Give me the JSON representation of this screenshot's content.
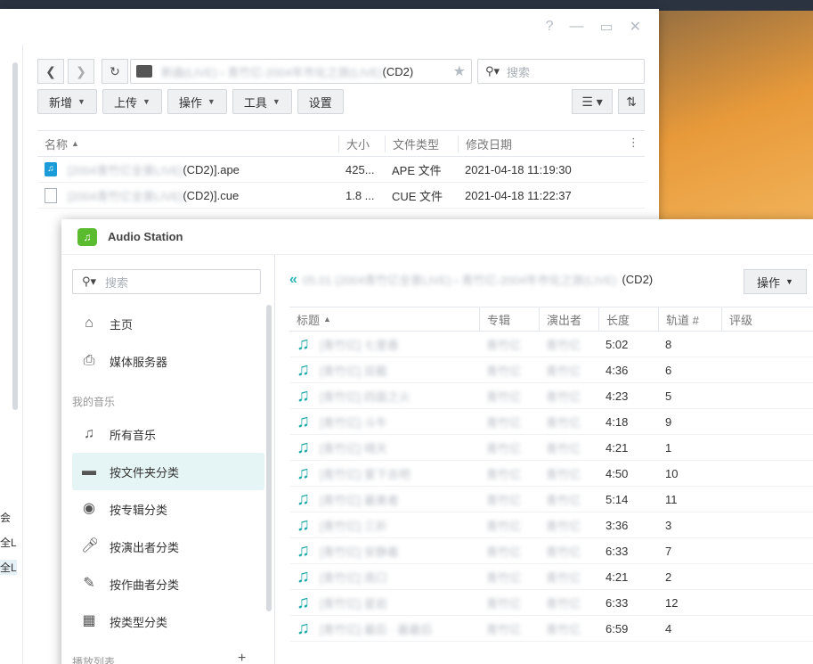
{
  "file_station": {
    "window_controls": [
      "?",
      "—",
      "▭",
      "✕"
    ],
    "path": {
      "blurred_prefix": "新曲(LIVE)  ›  青竹亿-2004年市化之旅(LIVE)",
      "visible_suffix": "(CD2)"
    },
    "search_placeholder": "搜索",
    "toolbar": {
      "new": "新增",
      "upload": "上传",
      "action": "操作",
      "tools": "工具",
      "settings": "设置"
    },
    "columns": {
      "name": "名称",
      "size": "大小",
      "type": "文件类型",
      "modified": "修改日期"
    },
    "files": [
      {
        "name_blurred": "[2004青竹亿全景LIVE]",
        "name_visible": "(CD2)].ape",
        "size": "425...",
        "type": "APE 文件",
        "modified": "2021-04-18 11:19:30",
        "icon": "audio-file-icon"
      },
      {
        "name_blurred": "[2004青竹亿全景LIVE]",
        "name_visible": "(CD2)].cue",
        "size": "1.8 ...",
        "type": "CUE 文件",
        "modified": "2021-04-18 11:22:37",
        "icon": "document-icon"
      }
    ],
    "side_texts": [
      "会",
      "全L",
      "全L"
    ]
  },
  "audio_station": {
    "title": "Audio Station",
    "search_placeholder": "搜索",
    "nav": {
      "home": "主页",
      "media_server": "媒体服务器",
      "my_music_section": "我的音乐",
      "all_music": "所有音乐",
      "by_folder": "按文件夹分类",
      "by_album": "按专辑分类",
      "by_artist": "按演出者分类",
      "by_composer": "按作曲者分类",
      "by_genre": "按类型分类",
      "playlist_section": "播放列表"
    },
    "breadcrumb": {
      "blurred": "05.01 (2004青竹亿全景LIVE)  ›  青竹亿-2004年市化之旅(LIVE)",
      "visible_suffix": "(CD2)"
    },
    "action_button": "操作",
    "columns": {
      "title": "标题",
      "album": "专辑",
      "artist": "演出者",
      "length": "长度",
      "track": "轨道 #",
      "rating": "评级"
    },
    "tracks": [
      {
        "title": "[青竹亿]  七里香",
        "album": "青竹亿",
        "artist": "青竹亿",
        "length": "5:02",
        "track": "8"
      },
      {
        "title": "[青竹亿]  双截",
        "album": "青竹亿",
        "artist": "青竹亿",
        "length": "4:36",
        "track": "6"
      },
      {
        "title": "[青竹亿]  四面之火",
        "album": "青竹亿",
        "artist": "青竹亿",
        "length": "4:23",
        "track": "5"
      },
      {
        "title": "[青竹亿]  斗牛",
        "album": "青竹亿",
        "artist": "青竹亿",
        "length": "4:18",
        "track": "9"
      },
      {
        "title": "[青竹亿]  晴天",
        "album": "青竹亿",
        "artist": "青竹亿",
        "length": "4:21",
        "track": "1"
      },
      {
        "title": "[青竹亿]  爱下去吧",
        "album": "青竹亿",
        "artist": "青竹亿",
        "length": "4:50",
        "track": "10"
      },
      {
        "title": "[青竹亿]  最美者",
        "album": "青竹亿",
        "artist": "青竹亿",
        "length": "5:14",
        "track": "11"
      },
      {
        "title": "[青竹亿]  三折",
        "album": "青竹亿",
        "artist": "青竹亿",
        "length": "3:36",
        "track": "3"
      },
      {
        "title": "[青竹亿]  安静着",
        "album": "青竹亿",
        "artist": "青竹亿",
        "length": "6:33",
        "track": "7"
      },
      {
        "title": "[青竹亿]  南口",
        "album": "青竹亿",
        "artist": "青竹亿",
        "length": "4:21",
        "track": "2"
      },
      {
        "title": "[青竹亿]  星岩",
        "album": "青竹亿",
        "artist": "青竹亿",
        "length": "6:33",
        "track": "12"
      },
      {
        "title": "[青竹亿]  最后 · 最最后",
        "album": "青竹亿",
        "artist": "青竹亿",
        "length": "6:59",
        "track": "4"
      }
    ]
  }
}
